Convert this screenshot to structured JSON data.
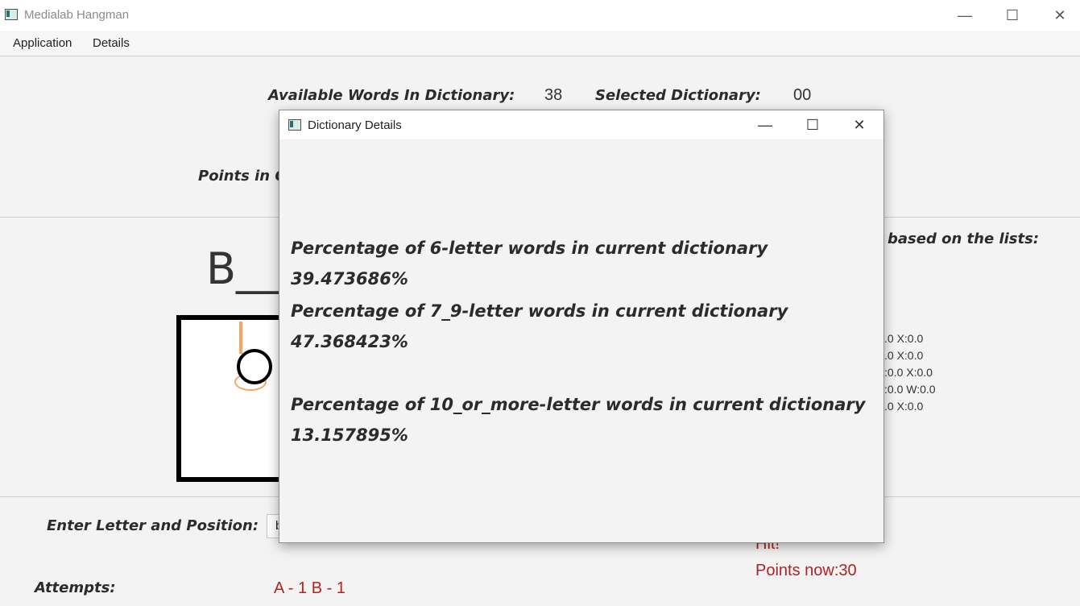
{
  "window": {
    "title": "Medialab Hangman",
    "minimize_glyph": "—",
    "maximize_glyph": "☐",
    "close_glyph": "✕"
  },
  "menu": {
    "items": [
      "Application",
      "Details"
    ]
  },
  "header": {
    "available_label": "Available Words In Dictionary:",
    "available_value": "38",
    "selected_label": "Selected Dictionary:",
    "selected_value": "00",
    "points_label_partial": "Points in C"
  },
  "word": {
    "display": "B___"
  },
  "side_panel": {
    "heading_partial": "based on the lists:",
    "lines": [
      ".0 X:0.0",
      ".0 X:0.0",
      ":0.0 X:0.0",
      ":0.0 W:0.0",
      ".0 X:0.0"
    ]
  },
  "input_section": {
    "label": "Enter Letter and Position:",
    "value": "b"
  },
  "attempts": {
    "label": "Attempts:",
    "value": "A - 1  B - 1"
  },
  "result": {
    "hit_text": "Hit!",
    "points_text": "Points now:30"
  },
  "dialog": {
    "title": "Dictionary Details",
    "minimize_glyph": "—",
    "maximize_glyph": "☐",
    "close_glyph": "✕",
    "stat1": "Percentage of 6-letter words in current dictionary 39.473686%",
    "stat2": "Percentage of 7_9-letter words in current dictionary 47.368423%",
    "stat3": "Percentage of 10_or_more-letter words in current dictionary 13.157895%"
  },
  "colors": {
    "accent_red": "#b22222",
    "rope": "#f0a861"
  }
}
